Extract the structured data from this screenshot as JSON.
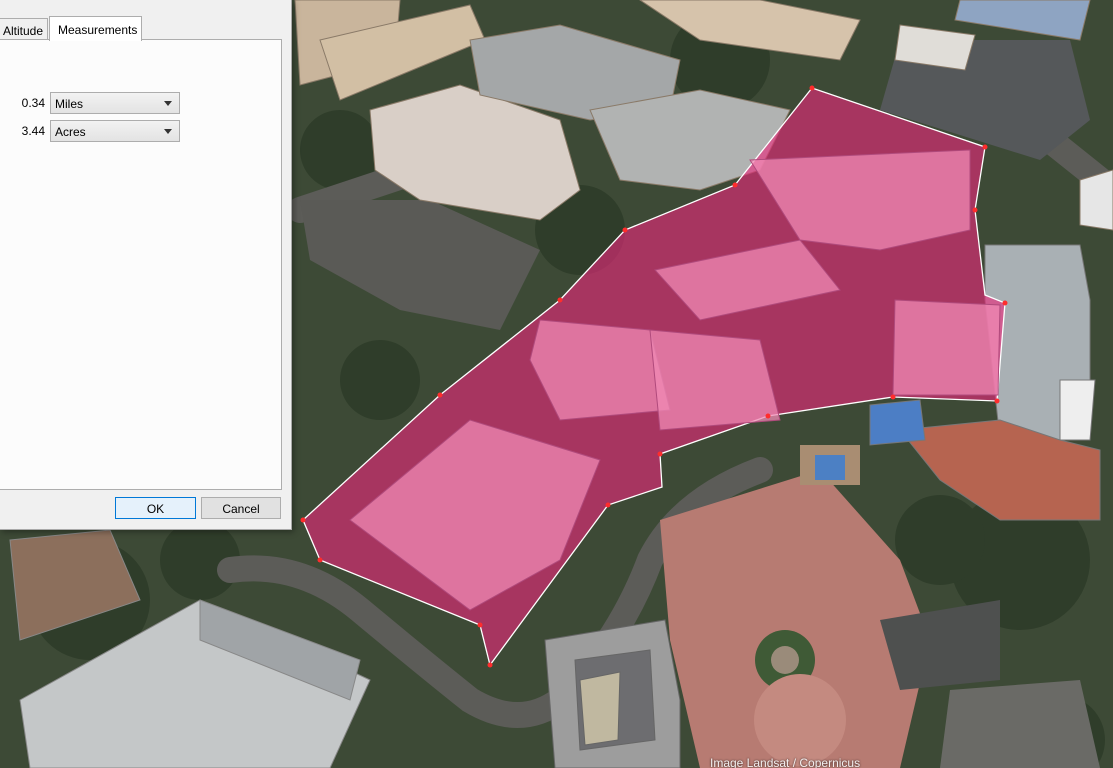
{
  "dialog": {
    "tabs": [
      {
        "label": "Altitude"
      },
      {
        "label": "Measurements"
      }
    ],
    "measurements": [
      {
        "value": "0.34",
        "unit": "Miles"
      },
      {
        "value": "3.44",
        "unit": "Acres"
      }
    ],
    "ok_label": "OK",
    "cancel_label": "Cancel"
  },
  "map": {
    "attribution": "Image Landsat / Copernicus",
    "polygon_fill": "#e8287a",
    "polygon_edge": "#ffffff"
  }
}
